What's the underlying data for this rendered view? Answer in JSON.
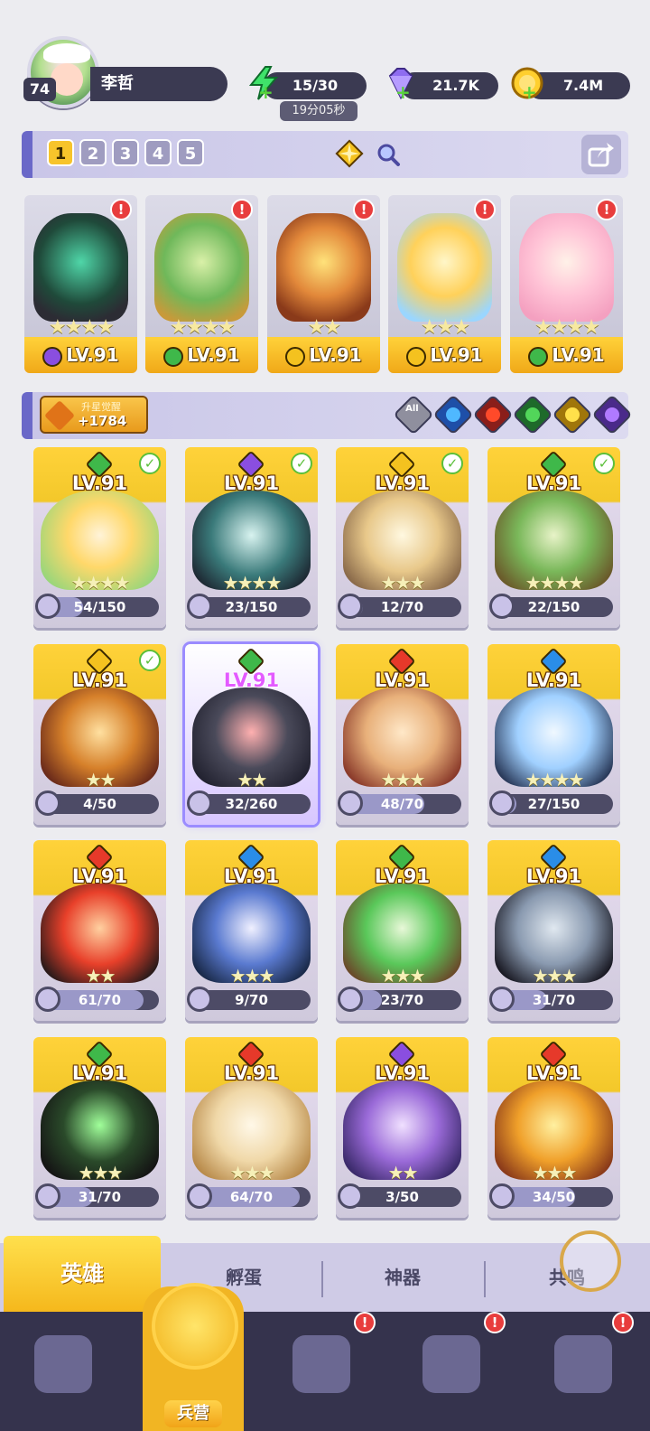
{
  "player": {
    "level": "74",
    "name": "李哲"
  },
  "resources": {
    "energy": "15/30",
    "energy_timer": "19分05秒",
    "gems": "21.7K",
    "gold": "7.4M"
  },
  "team_tabs": [
    "1",
    "2",
    "3",
    "4",
    "5"
  ],
  "team_active": 0,
  "team_heroes": [
    {
      "level": "LV.91",
      "element": "dark",
      "stars": "★★★★",
      "alert": true
    },
    {
      "level": "LV.91",
      "element": "nature",
      "stars": "★★★★",
      "alert": true
    },
    {
      "level": "LV.91",
      "element": "light",
      "stars": "★★",
      "alert": true
    },
    {
      "level": "LV.91",
      "element": "light",
      "stars": "★★★",
      "alert": true
    },
    {
      "level": "LV.91",
      "element": "nature",
      "stars": "★★★★",
      "alert": true
    }
  ],
  "awaken": {
    "title": "升星觉醒",
    "value": "+1784"
  },
  "filters": {
    "all_label": "All",
    "elements": [
      "water",
      "fire",
      "nature",
      "light",
      "dark"
    ]
  },
  "heroes": [
    {
      "level": "LV.91",
      "element": "nature",
      "check": true,
      "stars": "★★★★",
      "progress": "54/150",
      "fraction": 0.36
    },
    {
      "level": "LV.91",
      "element": "dark",
      "check": true,
      "stars": "★★★★",
      "progress": "23/150",
      "fraction": 0.153
    },
    {
      "level": "LV.91",
      "element": "light",
      "check": true,
      "stars": "★★★",
      "progress": "12/70",
      "fraction": 0.171
    },
    {
      "level": "LV.91",
      "element": "nature",
      "check": true,
      "stars": "★★★★",
      "progress": "22/150",
      "fraction": 0.147
    },
    {
      "level": "LV.91",
      "element": "light",
      "check": true,
      "stars": "★★",
      "progress": "4/50",
      "fraction": 0.08
    },
    {
      "level": "LV.91",
      "element": "nature",
      "check": false,
      "stars": "★★",
      "progress": "32/260",
      "fraction": 0.123,
      "selected": true
    },
    {
      "level": "LV.91",
      "element": "fire",
      "check": false,
      "stars": "★★★",
      "progress": "48/70",
      "fraction": 0.686
    },
    {
      "level": "LV.91",
      "element": "water",
      "check": false,
      "stars": "★★★★",
      "progress": "27/150",
      "fraction": 0.18
    },
    {
      "level": "LV.91",
      "element": "fire",
      "check": false,
      "stars": "★★",
      "progress": "61/70",
      "fraction": 0.871
    },
    {
      "level": "LV.91",
      "element": "water",
      "check": false,
      "stars": "★★★",
      "progress": "9/70",
      "fraction": 0.129
    },
    {
      "level": "LV.91",
      "element": "nature",
      "check": false,
      "stars": "★★★",
      "progress": "23/70",
      "fraction": 0.329
    },
    {
      "level": "LV.91",
      "element": "water",
      "check": false,
      "stars": "★★★",
      "progress": "31/70",
      "fraction": 0.443
    },
    {
      "level": "LV.91",
      "element": "nature",
      "check": false,
      "stars": "★★★",
      "progress": "31/70",
      "fraction": 0.443
    },
    {
      "level": "LV.91",
      "element": "fire",
      "check": false,
      "stars": "★★★",
      "progress": "64/70",
      "fraction": 0.914
    },
    {
      "level": "LV.91",
      "element": "dark",
      "check": false,
      "stars": "★★",
      "progress": "3/50",
      "fraction": 0.06
    },
    {
      "level": "LV.91",
      "element": "fire",
      "check": false,
      "stars": "★★★",
      "progress": "34/50",
      "fraction": 0.68
    }
  ],
  "subtabs": [
    "英雄",
    "孵蛋",
    "神器",
    "共鸣"
  ],
  "subtab_active": 0,
  "nav": {
    "items": [
      "cards-icon",
      "barracks-icon",
      "map-icon",
      "temple-icon",
      "mushroom-icon"
    ],
    "active_label": "兵营",
    "alerts": [
      false,
      false,
      true,
      true,
      true
    ]
  },
  "colors": {
    "nature": "#3fb84a",
    "dark": "#8a4ee0",
    "light": "#f4c21f",
    "fire": "#e6392a",
    "water": "#2a8de8",
    "accent": "#f7c42b"
  }
}
